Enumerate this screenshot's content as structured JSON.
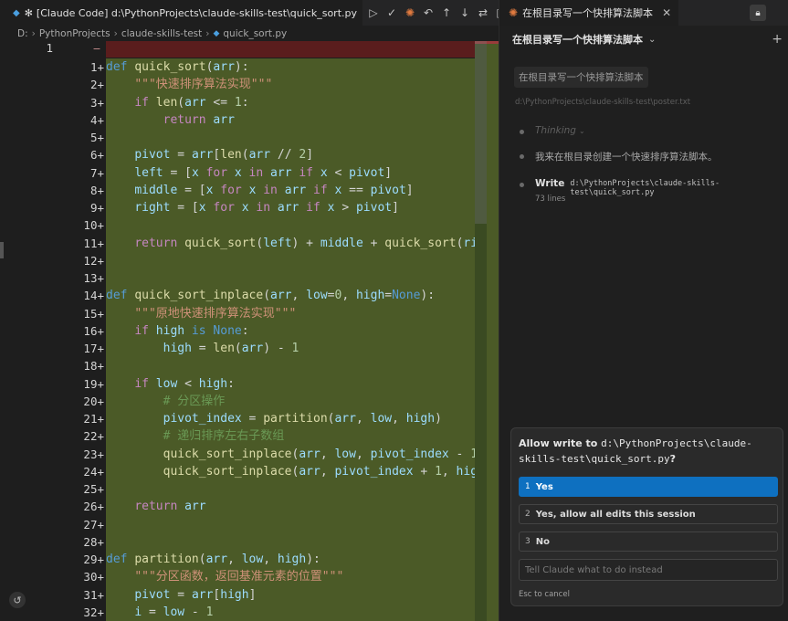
{
  "editor": {
    "tab_title": "[Claude Code] d:\\PythonProjects\\claude-skills-test\\quick_sort.py",
    "breadcrumb": [
      "D:",
      "PythonProjects",
      "claude-skills-test",
      "quick_sort.py"
    ],
    "old_line_number": "1",
    "deleted_marker": "−",
    "line_numbers": [
      "1+",
      "2+",
      "3+",
      "4+",
      "5+",
      "6+",
      "7+",
      "8+",
      "9+",
      "10+",
      "11+",
      "12+",
      "13+",
      "14+",
      "15+",
      "16+",
      "17+",
      "18+",
      "19+",
      "20+",
      "21+",
      "22+",
      "23+",
      "24+",
      "25+",
      "26+",
      "27+",
      "28+",
      "29+",
      "30+",
      "31+",
      "32+"
    ],
    "code_lines": [
      [
        [
          "kw",
          "def "
        ],
        [
          "fn",
          "quick_sort"
        ],
        [
          "",
          "("
        ],
        [
          "prm",
          "arr"
        ],
        [
          "",
          "):"
        ]
      ],
      [
        [
          "",
          "    "
        ],
        [
          "str",
          "\"\"\"快速排序算法实现\"\"\""
        ]
      ],
      [
        [
          "",
          "    "
        ],
        [
          "ctrl",
          "if "
        ],
        [
          "fn",
          "len"
        ],
        [
          "",
          "("
        ],
        [
          "prm",
          "arr"
        ],
        [
          "",
          " <= "
        ],
        [
          "num",
          "1"
        ],
        [
          "",
          ":"
        ]
      ],
      [
        [
          "",
          "        "
        ],
        [
          "ctrl",
          "return "
        ],
        [
          "prm",
          "arr"
        ]
      ],
      [],
      [
        [
          "",
          "    "
        ],
        [
          "prm",
          "pivot"
        ],
        [
          "",
          " = "
        ],
        [
          "prm",
          "arr"
        ],
        [
          "",
          "["
        ],
        [
          "fn",
          "len"
        ],
        [
          "",
          "("
        ],
        [
          "prm",
          "arr"
        ],
        [
          "",
          " // "
        ],
        [
          "num",
          "2"
        ],
        [
          "",
          "]"
        ]
      ],
      [
        [
          "",
          "    "
        ],
        [
          "prm",
          "left"
        ],
        [
          "",
          " = ["
        ],
        [
          "prm",
          "x"
        ],
        [
          "ctrl",
          " for "
        ],
        [
          "prm",
          "x"
        ],
        [
          "ctrl",
          " in "
        ],
        [
          "prm",
          "arr"
        ],
        [
          "ctrl",
          " if "
        ],
        [
          "prm",
          "x"
        ],
        [
          "",
          " < "
        ],
        [
          "prm",
          "pivot"
        ],
        [
          "",
          "]"
        ]
      ],
      [
        [
          "",
          "    "
        ],
        [
          "prm",
          "middle"
        ],
        [
          "",
          " = ["
        ],
        [
          "prm",
          "x"
        ],
        [
          "ctrl",
          " for "
        ],
        [
          "prm",
          "x"
        ],
        [
          "ctrl",
          " in "
        ],
        [
          "prm",
          "arr"
        ],
        [
          "ctrl",
          " if "
        ],
        [
          "prm",
          "x"
        ],
        [
          "",
          " == "
        ],
        [
          "prm",
          "pivot"
        ],
        [
          "",
          "]"
        ]
      ],
      [
        [
          "",
          "    "
        ],
        [
          "prm",
          "right"
        ],
        [
          "",
          " = ["
        ],
        [
          "prm",
          "x"
        ],
        [
          "ctrl",
          " for "
        ],
        [
          "prm",
          "x"
        ],
        [
          "ctrl",
          " in "
        ],
        [
          "prm",
          "arr"
        ],
        [
          "ctrl",
          " if "
        ],
        [
          "prm",
          "x"
        ],
        [
          "",
          " > "
        ],
        [
          "prm",
          "pivot"
        ],
        [
          "",
          "]"
        ]
      ],
      [],
      [
        [
          "",
          "    "
        ],
        [
          "ctrl",
          "return "
        ],
        [
          "fn",
          "quick_sort"
        ],
        [
          "",
          "("
        ],
        [
          "prm",
          "left"
        ],
        [
          "",
          ") + "
        ],
        [
          "prm",
          "middle"
        ],
        [
          "",
          " + "
        ],
        [
          "fn",
          "quick_sort"
        ],
        [
          "",
          "("
        ],
        [
          "prm",
          "right"
        ],
        [
          "",
          ")"
        ]
      ],
      [],
      [],
      [
        [
          "kw",
          "def "
        ],
        [
          "fn",
          "quick_sort_inplace"
        ],
        [
          "",
          "("
        ],
        [
          "prm",
          "arr"
        ],
        [
          "",
          ", "
        ],
        [
          "prm",
          "low"
        ],
        [
          "",
          "="
        ],
        [
          "num",
          "0"
        ],
        [
          "",
          ", "
        ],
        [
          "prm",
          "high"
        ],
        [
          "",
          "="
        ],
        [
          "kw",
          "None"
        ],
        [
          "",
          "):"
        ]
      ],
      [
        [
          "",
          "    "
        ],
        [
          "str",
          "\"\"\"原地快速排序算法实现\"\"\""
        ]
      ],
      [
        [
          "",
          "    "
        ],
        [
          "ctrl",
          "if "
        ],
        [
          "prm",
          "high"
        ],
        [
          "kw",
          " is "
        ],
        [
          "kw",
          "None"
        ],
        [
          "",
          ":"
        ]
      ],
      [
        [
          "",
          "        "
        ],
        [
          "prm",
          "high"
        ],
        [
          "",
          " = "
        ],
        [
          "fn",
          "len"
        ],
        [
          "",
          "("
        ],
        [
          "prm",
          "arr"
        ],
        [
          "",
          ") - "
        ],
        [
          "num",
          "1"
        ]
      ],
      [],
      [
        [
          "",
          "    "
        ],
        [
          "ctrl",
          "if "
        ],
        [
          "prm",
          "low"
        ],
        [
          "",
          " < "
        ],
        [
          "prm",
          "high"
        ],
        [
          "",
          ":"
        ]
      ],
      [
        [
          "",
          "        "
        ],
        [
          "cmt",
          "# 分区操作"
        ]
      ],
      [
        [
          "",
          "        "
        ],
        [
          "prm",
          "pivot_index"
        ],
        [
          "",
          " = "
        ],
        [
          "fn",
          "partition"
        ],
        [
          "",
          "("
        ],
        [
          "prm",
          "arr"
        ],
        [
          "",
          ", "
        ],
        [
          "prm",
          "low"
        ],
        [
          "",
          ", "
        ],
        [
          "prm",
          "high"
        ],
        [
          "",
          ")"
        ]
      ],
      [
        [
          "",
          "        "
        ],
        [
          "cmt",
          "# 递归排序左右子数组"
        ]
      ],
      [
        [
          "",
          "        "
        ],
        [
          "fn",
          "quick_sort_inplace"
        ],
        [
          "",
          "("
        ],
        [
          "prm",
          "arr"
        ],
        [
          "",
          ", "
        ],
        [
          "prm",
          "low"
        ],
        [
          "",
          ", "
        ],
        [
          "prm",
          "pivot_index"
        ],
        [
          "",
          " - "
        ],
        [
          "num",
          "1"
        ],
        [
          "",
          ")"
        ]
      ],
      [
        [
          "",
          "        "
        ],
        [
          "fn",
          "quick_sort_inplace"
        ],
        [
          "",
          "("
        ],
        [
          "prm",
          "arr"
        ],
        [
          "",
          ", "
        ],
        [
          "prm",
          "pivot_index"
        ],
        [
          "",
          " + "
        ],
        [
          "num",
          "1"
        ],
        [
          "",
          ", "
        ],
        [
          "prm",
          "high"
        ],
        [
          "",
          ")"
        ]
      ],
      [],
      [
        [
          "",
          "    "
        ],
        [
          "ctrl",
          "return "
        ],
        [
          "prm",
          "arr"
        ]
      ],
      [],
      [],
      [
        [
          "kw",
          "def "
        ],
        [
          "fn",
          "partition"
        ],
        [
          "",
          "("
        ],
        [
          "prm",
          "arr"
        ],
        [
          "",
          ", "
        ],
        [
          "prm",
          "low"
        ],
        [
          "",
          ", "
        ],
        [
          "prm",
          "high"
        ],
        [
          "",
          "):"
        ]
      ],
      [
        [
          "",
          "    "
        ],
        [
          "str",
          "\"\"\"分区函数，返回基准元素的位置\"\"\""
        ]
      ],
      [
        [
          "",
          "    "
        ],
        [
          "prm",
          "pivot"
        ],
        [
          "",
          " = "
        ],
        [
          "prm",
          "arr"
        ],
        [
          "",
          "["
        ],
        [
          "prm",
          "high"
        ],
        [
          "",
          "]"
        ]
      ],
      [
        [
          "",
          "    "
        ],
        [
          "prm",
          "i"
        ],
        [
          "",
          " = "
        ],
        [
          "prm",
          "low"
        ],
        [
          "",
          " - "
        ],
        [
          "num",
          "1"
        ]
      ]
    ]
  },
  "panel": {
    "tab_title": "在根目录写一个快排算法脚本",
    "header_title": "在根目录写一个快排算法脚本",
    "user_message": "在根目录写一个快排算法脚本",
    "context_path": "d:\\PythonProjects\\claude-skills-test\\poster.txt",
    "thinking_label": "Thinking",
    "assistant_message": "我来在根目录创建一个快速排序算法脚本。",
    "write_label": "Write",
    "write_path": "d:\\PythonProjects\\claude-skills-test\\quick_sort.py",
    "write_lines": "73 lines",
    "dialog": {
      "question_prefix": "Allow write to ",
      "question_path": "d:\\PythonProjects\\claude-skills-test\\quick_sort.py",
      "question_suffix": "?",
      "options": [
        {
          "num": "1",
          "label": "Yes"
        },
        {
          "num": "2",
          "label": "Yes, allow all edits this session"
        },
        {
          "num": "3",
          "label": "No"
        }
      ],
      "instead_placeholder": "Tell Claude what to do instead",
      "esc_hint": "Esc to cancel"
    }
  }
}
